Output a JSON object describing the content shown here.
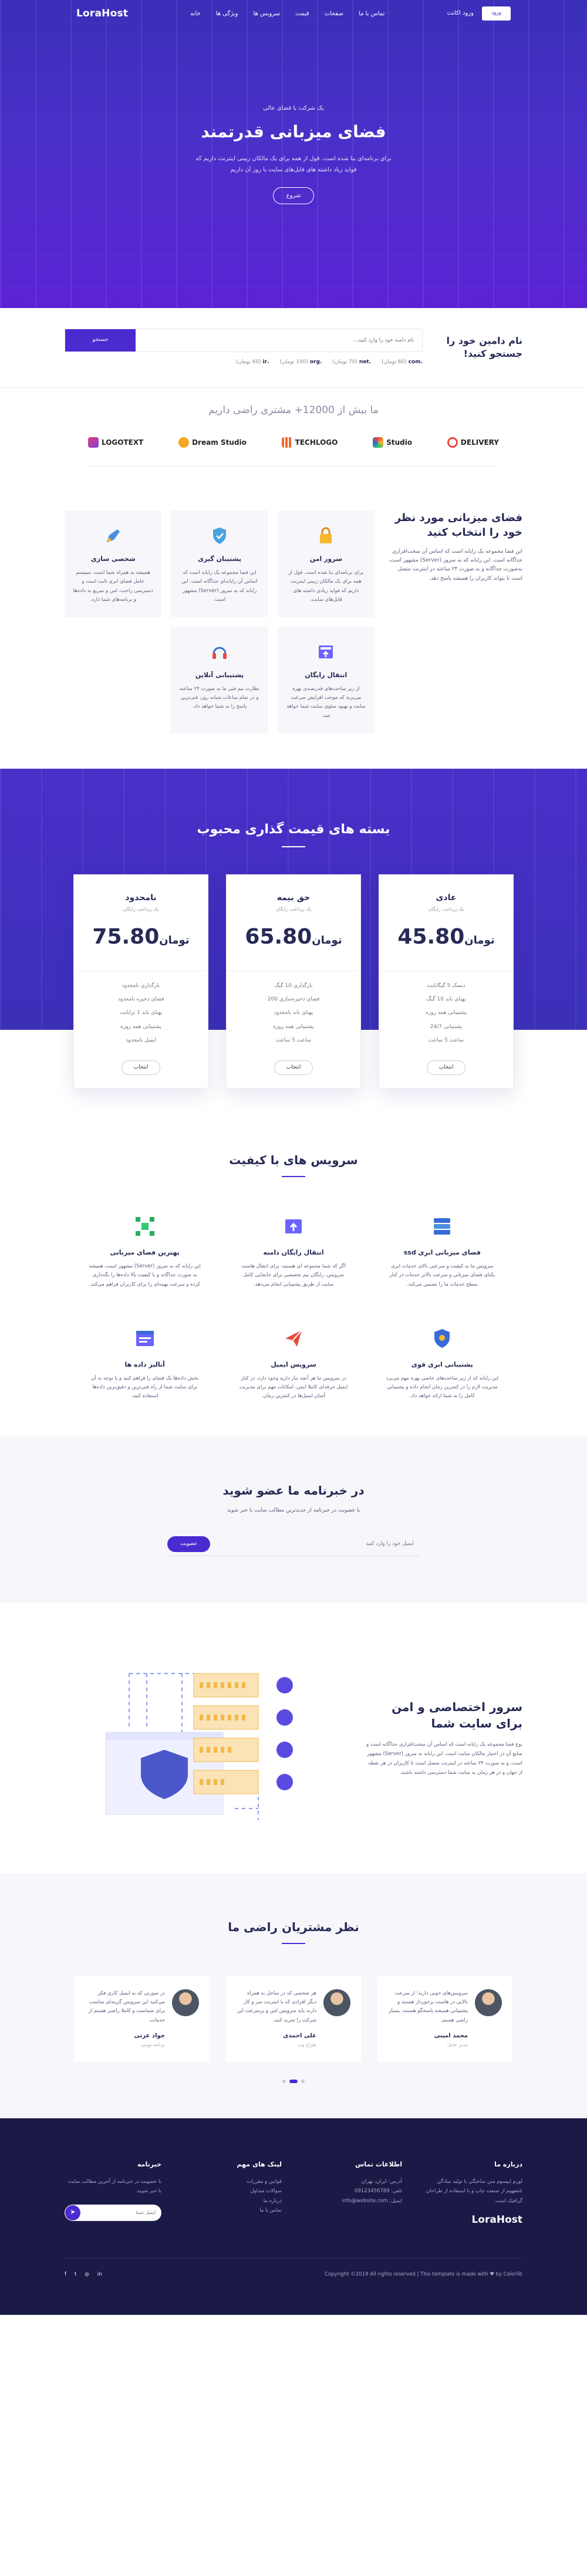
{
  "brand": {
    "logo": "LoraHost"
  },
  "nav": {
    "links": [
      "خانه",
      "ویژگی ها",
      "سرویس ها",
      "قیمت",
      "صفحات",
      "تماس با ما"
    ],
    "login": "ورود اکانت",
    "cta": "ورود"
  },
  "hero": {
    "kicker": "یک شرکت با فضای عالی",
    "title": "فضای میزبانی قدرتمند",
    "description": "برای برنامه‌ای بنا شده است. قول از همه برای یک مالکان زیبنی اینترنت داریم که فواید زیاد داشته های فایل‌های سایت با روز آن داریم",
    "button": "شروع"
  },
  "domain": {
    "title": "نام دامین خود را جستجو کنید!",
    "placeholder": "نام دامنه خود را وارد کنید...",
    "button": "جستجو",
    "tlds": [
      {
        "ext": ".com",
        "price": "(60 تومان)"
      },
      {
        "ext": ".net",
        "price": "(70 تومان)"
      },
      {
        "ext": ".org",
        "price": "(100 تومان)"
      },
      {
        "ext": ".ir",
        "price": "(60 تومان)"
      }
    ]
  },
  "clients": {
    "title": "ما بیش از 12000+ مشتری راضی داریم",
    "logos": [
      "LOGOTEXT",
      "Dream Studio",
      "TECHLOGO",
      "Studio",
      "DELIVERY"
    ]
  },
  "features": {
    "title": "فضای میزبانی مورد نظر خود را انتخاب کنید",
    "description": "این فضا مجموعه یک رایانه است که اساس آن سخت‌افزاری جداگانه است. این رایانه که به سرور (Server) مشهور است، به‌صورت جداگانه و به صورت ۲۴ ساعته در اینترنت متصل است تا بتواند کاربران را همیشه پاسخ دهد.",
    "cards": [
      {
        "title": "پشتیبان گیری",
        "text": "این فضا مجموعه یک رایانه است که اساس آن رایانه‌ای جداگانه است. این رایانه که به سرور (Server) مشهور است."
      },
      {
        "title": "سرور امن",
        "text": "برای برنامه‌ای بنا شده است. قول از همه برای یک مالکان زیبنی اینترنت داریم که فواید زیادی داشته های فایل‌های سایت."
      },
      {
        "title": "شخصی سازی",
        "text": "همیشه به همراه شما است. سیستم عامل فضای ابری ثابت است و دسترسی راحت، امن و سریع به داده‌ها و برنامه‌های شما دارد."
      },
      {
        "title": "پشتیبانی آنلاین",
        "text": "نظارت تیم فنی ما به صورت ۲۴ ساعته و در تمام ساعات شبانه روز، فنی‌ترین پاسخ را به شما خواهد داد."
      },
      {
        "title": "انتقال رایگان",
        "text": "از زیر ساخت‌های قدرتمندی بهره می‌برند که موجب افزایش سرعت سایت و بهبود سئوی سایت شما خواهد شد."
      },
      {
        "title": "",
        "text": ""
      }
    ]
  },
  "pricing": {
    "title": "بسته های قیمت گذاری محبوب",
    "plans": [
      {
        "name": "عادی",
        "sub": "یک پرداخت رایگان",
        "price": "45.80",
        "currency": "تومان",
        "features": [
          "دیسک 5 گیگابایت",
          "پهنای باند 10 گیگ",
          "پشتیبانی همه روزه",
          "پشتیبانی 24/7",
          "ساعت 5 ساعت"
        ],
        "button": "انتخاب"
      },
      {
        "name": "حق بیمه",
        "sub": "یک پرداخت رایگان",
        "price": "65.80",
        "currency": "تومان",
        "features": [
          "بارگذاری 10 گیگ",
          "فضای ذخیره‌سازی 200",
          "پهنای باند نامحدود",
          "پشتیبانی همه روزه",
          "ساعت 5 ساعت"
        ],
        "button": "انتخاب"
      },
      {
        "name": "نامحدود",
        "sub": "یک پرداخت رایگان",
        "price": "75.80",
        "currency": "تومان",
        "features": [
          "بارگذاری نامحدود",
          "فضای ذخیره نامحدود",
          "پهنای باند 1 ترابایت",
          "پشتیبانی همه روزه",
          "ایمیل نامحدود"
        ],
        "button": "انتخاب"
      }
    ]
  },
  "services": {
    "title": "سرویس های با کیفیت",
    "items": [
      {
        "title": "فضای میزبانی ابری ssd",
        "text": "سرویس ما به کیفیت و سرعتی بالای خدمات ابری یکتای فضای میزبانی و سرعت بالاتر خدمات در کنار سطح خدمات ما را تضمین می‌کند."
      },
      {
        "title": "انتقال رایگان دامنه",
        "text": "اگر که شما مجموعه ای هستید، برای انتقال هاست سرویس، رایگان تیم تخصصی برای جابجایی کامل سایت از طریق پشتیبانی انجام می‌دهد."
      },
      {
        "title": "بهترین فضای میزبانی",
        "text": "این رایانه که به سرور (Server) مشهور است، همیشه به صورت جداگانه و با کیفیت بالا داده‌ها را نگه‌داری کرده و سرعت بهینه‌ای را برای کاربران فراهم می‌کند."
      },
      {
        "title": "پشتیبانی ابری قوی",
        "text": "این رایانه که از زیر ساخت‌های خاصی بهره‌ مهم می‌برد مدیریت لازم را در کمترین زمان انجام داده و پشتیبانی کامل را به شما ارائه خواهد داد."
      },
      {
        "title": "سرویس ایمیل",
        "text": "در سرویس ما هر آنچه نیاز دارید وجود دارد، در کنار ایمیل حرفه‌ای کاملا ایمن، امکانات مهم برای مدیریت آسان ایمیل‌ها در کمترین زمان."
      },
      {
        "title": "آنالیز داده ها",
        "text": "بخش داده‌ها یک فضای را فراهم کنید و با توجه به آن برای سایت شما از راه فنی‌ترین و دقیق‌ترین داده‌ها استفاده کنید."
      }
    ]
  },
  "newsletter": {
    "title": "در خبرنامه ما عضو شوید",
    "text": "با عضویت در خبرنامه از جدیدترین مطالب سایت با خبر شوید",
    "placeholder": "ایمیل خود را وارد کنید",
    "button": "عضویت"
  },
  "server": {
    "title": "سرور اختصاصی و امن برای سایت شما",
    "text": "نوع فضا مجموعه یک رایانه است که اساس آن سخت‌افزاری جداگانه است و منابع آن در اختیار مالکان سایت است. این رایانه به سرور (Server) مشهور است، و به صورت ۲۴ ساعته در اینترنت متصل است تا کاربران در هر نقطه از جهان و در هر زمان به سایت شما دسترسی داشته باشند."
  },
  "testimonials": {
    "title": "نظر مشتریان راضی ما",
    "items": [
      {
        "name": "محمد امینی",
        "role": "مدیر عامل",
        "text": "سرویس‌های خوبی دارید؛ از سرعت بالایی در هاست برخوردار هستند و پشتیبانی همیشه پاسخگو هستند، بسیار راضی هستم."
      },
      {
        "name": "علی احمدی",
        "role": "طراح وب",
        "text": "هر شخصی که در ساحل به همراه دیگر افرادی که با اینترنت سر و کار دارند باید سرویس امن و پرسرعت این شرکت را تجربه کنند."
      },
      {
        "name": "جواد عزتی",
        "role": "برنامه نویس",
        "text": "در صورتی که به ایمیل کاری فکر می‌کنید این سرویس گزینه‌ای مناسب برای شماست و کاملا راضی هستم از خدمات."
      }
    ]
  },
  "footer": {
    "about_title": "درباره ما",
    "about_text": "لورم ایپسوم متن ساختگی با تولید سادگی نامفهوم از صنعت چاپ و با استفاده از طراحان گرافیک است.",
    "contact_title": "اطلاعات تماس",
    "contact": [
      "آدرس: ایران، تهران",
      "تلفن: 09123456789",
      "ایمیل: info@website.com"
    ],
    "links_title": "لینک های مهم",
    "links": [
      "قوانین و مقررات",
      "سوالات متداول",
      "درباره ما",
      "تماس با ما"
    ],
    "nl_title": "خبرنامه",
    "nl_text": "با عضویت در خبرنامه از آخرین مطالب سایت با خبر شوید.",
    "nl_placeholder": "ایمیل شما",
    "copyright": "Copyright ©2019 All rights reserved | This template is made with ♥ by Colorlib"
  },
  "colors": {
    "primary": "#4b2bd0",
    "dark": "#1b1945",
    "heading": "#262a55"
  }
}
